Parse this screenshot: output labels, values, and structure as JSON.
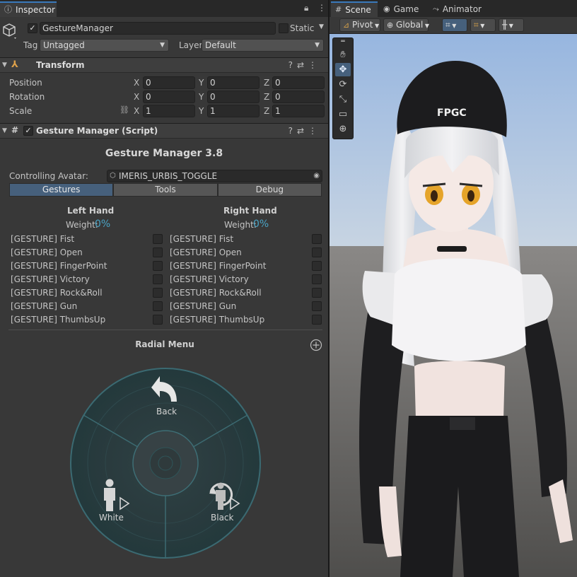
{
  "inspector": {
    "tab_label": "Inspector",
    "object": {
      "active": true,
      "name": "GestureManager",
      "static_label": "Static",
      "tag_label": "Tag",
      "tag_value": "Untagged",
      "layer_label": "Layer",
      "layer_value": "Default"
    },
    "transform": {
      "title": "Transform",
      "rows": [
        {
          "label": "Position",
          "x": "0",
          "y": "0",
          "z": "0"
        },
        {
          "label": "Rotation",
          "x": "0",
          "y": "0",
          "z": "0"
        },
        {
          "label": "Scale",
          "x": "1",
          "y": "1",
          "z": "1"
        }
      ],
      "axis_x": "X",
      "axis_y": "Y",
      "axis_z": "Z"
    },
    "gesture_manager": {
      "title": "Gesture Manager (Script)",
      "enabled": true,
      "heading": "Gesture Manager 3.8",
      "controlling_label": "Controlling Avatar:",
      "controlling_value": "IMERIS_URBIS_TOGGLE",
      "tabs": [
        "Gestures",
        "Tools",
        "Debug"
      ],
      "selected_tab": "Gestures",
      "left_hand": "Left Hand",
      "right_hand": "Right Hand",
      "weight_label": "Weight:",
      "left_weight": "0%",
      "right_weight": "0%",
      "gestures": [
        "[GESTURE] Fist",
        "[GESTURE] Open",
        "[GESTURE] FingerPoint",
        "[GESTURE] Victory",
        "[GESTURE] Rock&Roll",
        "[GESTURE] Gun",
        "[GESTURE] ThumbsUp"
      ],
      "radial_title": "Radial Menu",
      "radial": {
        "back": "Back",
        "white": "White",
        "black": "Black"
      }
    }
  },
  "scene": {
    "tabs": [
      "Scene",
      "Game",
      "Animator"
    ],
    "active_tab": "Scene",
    "toolbar": {
      "pivot": "Pivot",
      "global": "Global"
    },
    "cap_text": "FPGC",
    "colors": {
      "sky": "#aac3e6",
      "ground": "#5d5b58",
      "horizon": "#8e8c8a",
      "accent": "#46607c"
    }
  }
}
